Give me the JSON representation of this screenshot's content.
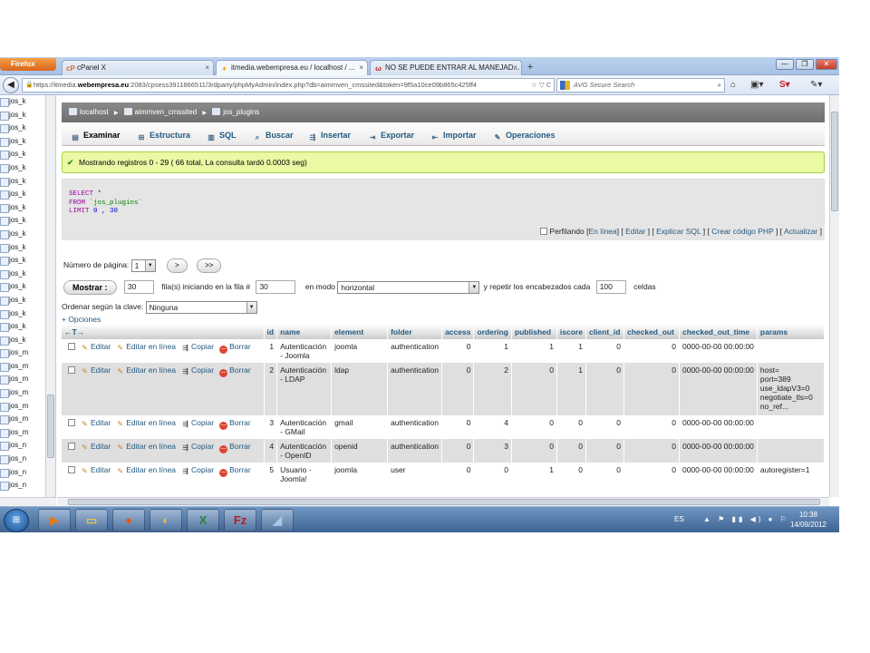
{
  "browser": {
    "menu_button": "Firefox",
    "tabs": [
      {
        "icon": "cP",
        "title": "cPanel X",
        "close": "×"
      },
      {
        "icon": "♦",
        "title": "itmedia.webempresa.eu / localhost / ...",
        "close": "×"
      },
      {
        "icon": "ω",
        "title": "NO SE PUEDE ENTRAR AL MANEJAD...",
        "close": "×"
      }
    ],
    "new_tab": "+",
    "window_controls": [
      "—",
      "❐",
      "✕"
    ],
    "url_prefix": "https://itmedia.",
    "url_domain": "webempresa.eu",
    "url_rest": ":2083/cpsess3911866511/3rdparty/phpMyAdmin/index.php?db=aimmven_cmssited&token=9f5a10ce09b865c425ff4",
    "url_tail": "☆ ▽ C",
    "search_placeholder": "AVG Secure Search",
    "back_glyph": "◀",
    "search_glyph": "⌕",
    "home_glyph": "⌂",
    "nav_right_icons": [
      "▣▾",
      "S▾",
      "✎▾"
    ]
  },
  "sidebar": {
    "items": [
      "jos_k",
      "jos_k",
      "jos_k",
      "jos_k",
      "jos_k",
      "jos_k",
      "jos_k",
      "jos_k",
      "jos_k",
      "jos_k",
      "jos_k",
      "jos_k",
      "jos_k",
      "jos_k",
      "jos_k",
      "jos_k",
      "jos_k",
      "jos_k",
      "jos_k",
      "jos_m",
      "jos_m",
      "jos_m",
      "jos_m",
      "jos_m",
      "jos_m",
      "jos_m",
      "jos_n",
      "jos_n",
      "jos_n",
      "jos_n"
    ]
  },
  "breadcrumb": {
    "server": "localhost",
    "database": "aimmven_cmssited",
    "table": "jos_plugins",
    "separator": "▶"
  },
  "tabs": [
    {
      "label": "Examinar",
      "icon": "▤"
    },
    {
      "label": "Estructura",
      "icon": "⊞"
    },
    {
      "label": "SQL",
      "icon": "▥"
    },
    {
      "label": "Buscar",
      "icon": "⌕"
    },
    {
      "label": "Insertar",
      "icon": "⇶"
    },
    {
      "label": "Exportar",
      "icon": "⇥"
    },
    {
      "label": "Importar",
      "icon": "⇤"
    },
    {
      "label": "Operaciones",
      "icon": "✎"
    }
  ],
  "success_message": "Mostrando registros 0 - 29 ( 66 total, La consulta tardó 0.0003 seg)",
  "success_icon": "✔",
  "sql": {
    "select": "SELECT",
    "star": " *",
    "from": "FROM",
    "table": " `jos_plugins`",
    "limit": "LIMIT",
    "limit_value": " 0 , 30"
  },
  "sql_links": {
    "profiling": "Perfilando",
    "inline": "En línea",
    "edit": "Editar",
    "explain": "Explicar SQL",
    "php": "Crear código PHP",
    "refresh": "Actualizar"
  },
  "pager": {
    "page_label": "Número de página:",
    "page_value": "1",
    "next": ">",
    "last": ">>"
  },
  "display": {
    "button": "Mostrar :",
    "rows": "30",
    "rows_label": "fila(s) iniciando en la fila #",
    "start": "30",
    "mode_label": "en modo",
    "mode": "horizontal",
    "repeat_label": "y repetir los encabezados cada",
    "repeat": "100",
    "cells_label": "celdas"
  },
  "order": {
    "label": "Ordenar según la clave:",
    "value": "Ninguna"
  },
  "options_link": "+ Opciones",
  "table": {
    "sort_arrows": "←T→",
    "headers": [
      "id",
      "name",
      "element",
      "folder",
      "access",
      "ordering",
      "published",
      "iscore",
      "client_id",
      "checked_out",
      "checked_out_time",
      "params"
    ],
    "actions": {
      "edit": "Editar",
      "inline": "Editar en línea",
      "copy": "Copiar",
      "delete": "Borrar"
    },
    "rows": [
      {
        "id": "1",
        "name": "Autenticación - Joomla",
        "element": "joomla",
        "folder": "authentication",
        "access": "0",
        "ordering": "1",
        "published": "1",
        "iscore": "1",
        "client_id": "0",
        "checked_out": "0",
        "checked_out_time": "0000-00-00 00:00:00",
        "params": ""
      },
      {
        "id": "2",
        "name": "Autenticación - LDAP",
        "element": "ldap",
        "folder": "authentication",
        "access": "0",
        "ordering": "2",
        "published": "0",
        "iscore": "1",
        "client_id": "0",
        "checked_out": "0",
        "checked_out_time": "0000-00-00 00:00:00",
        "params": "host= port=389 use_ldapV3=0 negotiate_tls=0 no_ref..."
      },
      {
        "id": "3",
        "name": "Autenticación - GMail",
        "element": "gmail",
        "folder": "authentication",
        "access": "0",
        "ordering": "4",
        "published": "0",
        "iscore": "0",
        "client_id": "0",
        "checked_out": "0",
        "checked_out_time": "0000-00-00 00:00:00",
        "params": ""
      },
      {
        "id": "4",
        "name": "Autenticación - OpenID",
        "element": "openid",
        "folder": "authentication",
        "access": "0",
        "ordering": "3",
        "published": "0",
        "iscore": "0",
        "client_id": "0",
        "checked_out": "0",
        "checked_out_time": "0000-00-00 00:00:00",
        "params": ""
      },
      {
        "id": "5",
        "name": "Usuario - Joomla!",
        "element": "joomla",
        "folder": "user",
        "access": "0",
        "ordering": "0",
        "published": "1",
        "iscore": "0",
        "client_id": "0",
        "checked_out": "0",
        "checked_out_time": "0000-00-00 00:00:00",
        "params": "autoregister=1"
      }
    ]
  },
  "taskbar": {
    "start": "⊞",
    "apps": [
      {
        "name": "media-player",
        "glyph": "▶",
        "color": "#e07a1f"
      },
      {
        "name": "explorer",
        "glyph": "▭",
        "color": "#e8c24a"
      },
      {
        "name": "firefox",
        "glyph": "●",
        "color": "#e0591c"
      },
      {
        "name": "windows-explorer",
        "glyph": "◐",
        "color": "#f0c040"
      },
      {
        "name": "excel",
        "glyph": "X",
        "color": "#2e7d32"
      },
      {
        "name": "filezilla",
        "glyph": "Fz",
        "color": "#b71c1c"
      },
      {
        "name": "app",
        "glyph": "◢",
        "color": "#a8c8e8"
      }
    ],
    "lang": "ES",
    "tray_icons": "▲ ⚑ ▮▮ ◀) ● ⚐",
    "time": "10:38",
    "date": "14/09/2012"
  }
}
